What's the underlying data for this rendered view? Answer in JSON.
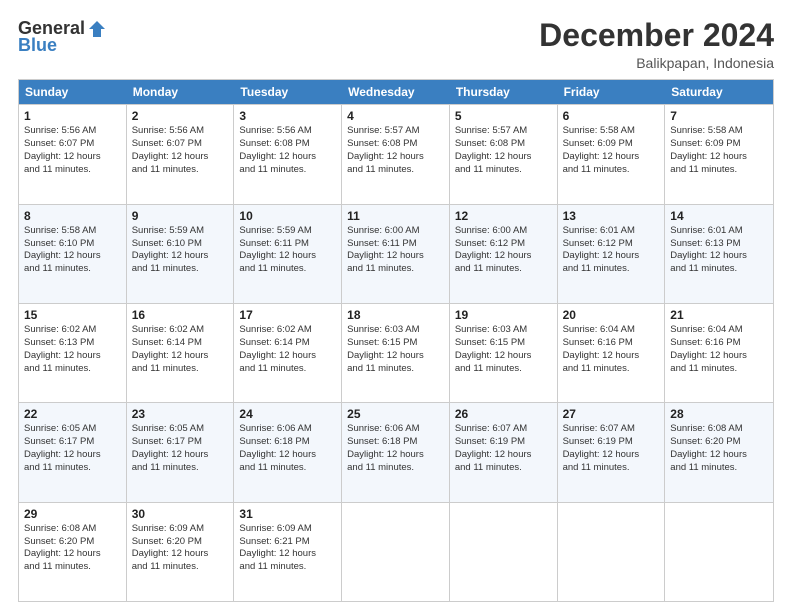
{
  "logo": {
    "general": "General",
    "blue": "Blue"
  },
  "header": {
    "title": "December 2024",
    "location": "Balikpapan, Indonesia"
  },
  "days": [
    "Sunday",
    "Monday",
    "Tuesday",
    "Wednesday",
    "Thursday",
    "Friday",
    "Saturday"
  ],
  "weeks": [
    [
      {
        "day": "1",
        "sunrise": "5:56 AM",
        "sunset": "6:07 PM",
        "daylight": "12 hours and 11 minutes."
      },
      {
        "day": "2",
        "sunrise": "5:56 AM",
        "sunset": "6:07 PM",
        "daylight": "12 hours and 11 minutes."
      },
      {
        "day": "3",
        "sunrise": "5:56 AM",
        "sunset": "6:08 PM",
        "daylight": "12 hours and 11 minutes."
      },
      {
        "day": "4",
        "sunrise": "5:57 AM",
        "sunset": "6:08 PM",
        "daylight": "12 hours and 11 minutes."
      },
      {
        "day": "5",
        "sunrise": "5:57 AM",
        "sunset": "6:08 PM",
        "daylight": "12 hours and 11 minutes."
      },
      {
        "day": "6",
        "sunrise": "5:58 AM",
        "sunset": "6:09 PM",
        "daylight": "12 hours and 11 minutes."
      },
      {
        "day": "7",
        "sunrise": "5:58 AM",
        "sunset": "6:09 PM",
        "daylight": "12 hours and 11 minutes."
      }
    ],
    [
      {
        "day": "8",
        "sunrise": "5:58 AM",
        "sunset": "6:10 PM",
        "daylight": "12 hours and 11 minutes."
      },
      {
        "day": "9",
        "sunrise": "5:59 AM",
        "sunset": "6:10 PM",
        "daylight": "12 hours and 11 minutes."
      },
      {
        "day": "10",
        "sunrise": "5:59 AM",
        "sunset": "6:11 PM",
        "daylight": "12 hours and 11 minutes."
      },
      {
        "day": "11",
        "sunrise": "6:00 AM",
        "sunset": "6:11 PM",
        "daylight": "12 hours and 11 minutes."
      },
      {
        "day": "12",
        "sunrise": "6:00 AM",
        "sunset": "6:12 PM",
        "daylight": "12 hours and 11 minutes."
      },
      {
        "day": "13",
        "sunrise": "6:01 AM",
        "sunset": "6:12 PM",
        "daylight": "12 hours and 11 minutes."
      },
      {
        "day": "14",
        "sunrise": "6:01 AM",
        "sunset": "6:13 PM",
        "daylight": "12 hours and 11 minutes."
      }
    ],
    [
      {
        "day": "15",
        "sunrise": "6:02 AM",
        "sunset": "6:13 PM",
        "daylight": "12 hours and 11 minutes."
      },
      {
        "day": "16",
        "sunrise": "6:02 AM",
        "sunset": "6:14 PM",
        "daylight": "12 hours and 11 minutes."
      },
      {
        "day": "17",
        "sunrise": "6:02 AM",
        "sunset": "6:14 PM",
        "daylight": "12 hours and 11 minutes."
      },
      {
        "day": "18",
        "sunrise": "6:03 AM",
        "sunset": "6:15 PM",
        "daylight": "12 hours and 11 minutes."
      },
      {
        "day": "19",
        "sunrise": "6:03 AM",
        "sunset": "6:15 PM",
        "daylight": "12 hours and 11 minutes."
      },
      {
        "day": "20",
        "sunrise": "6:04 AM",
        "sunset": "6:16 PM",
        "daylight": "12 hours and 11 minutes."
      },
      {
        "day": "21",
        "sunrise": "6:04 AM",
        "sunset": "6:16 PM",
        "daylight": "12 hours and 11 minutes."
      }
    ],
    [
      {
        "day": "22",
        "sunrise": "6:05 AM",
        "sunset": "6:17 PM",
        "daylight": "12 hours and 11 minutes."
      },
      {
        "day": "23",
        "sunrise": "6:05 AM",
        "sunset": "6:17 PM",
        "daylight": "12 hours and 11 minutes."
      },
      {
        "day": "24",
        "sunrise": "6:06 AM",
        "sunset": "6:18 PM",
        "daylight": "12 hours and 11 minutes."
      },
      {
        "day": "25",
        "sunrise": "6:06 AM",
        "sunset": "6:18 PM",
        "daylight": "12 hours and 11 minutes."
      },
      {
        "day": "26",
        "sunrise": "6:07 AM",
        "sunset": "6:19 PM",
        "daylight": "12 hours and 11 minutes."
      },
      {
        "day": "27",
        "sunrise": "6:07 AM",
        "sunset": "6:19 PM",
        "daylight": "12 hours and 11 minutes."
      },
      {
        "day": "28",
        "sunrise": "6:08 AM",
        "sunset": "6:20 PM",
        "daylight": "12 hours and 11 minutes."
      }
    ],
    [
      {
        "day": "29",
        "sunrise": "6:08 AM",
        "sunset": "6:20 PM",
        "daylight": "12 hours and 11 minutes."
      },
      {
        "day": "30",
        "sunrise": "6:09 AM",
        "sunset": "6:20 PM",
        "daylight": "12 hours and 11 minutes."
      },
      {
        "day": "31",
        "sunrise": "6:09 AM",
        "sunset": "6:21 PM",
        "daylight": "12 hours and 11 minutes."
      },
      null,
      null,
      null,
      null
    ]
  ],
  "labels": {
    "sunrise": "Sunrise:",
    "sunset": "Sunset:",
    "daylight": "Daylight:"
  }
}
